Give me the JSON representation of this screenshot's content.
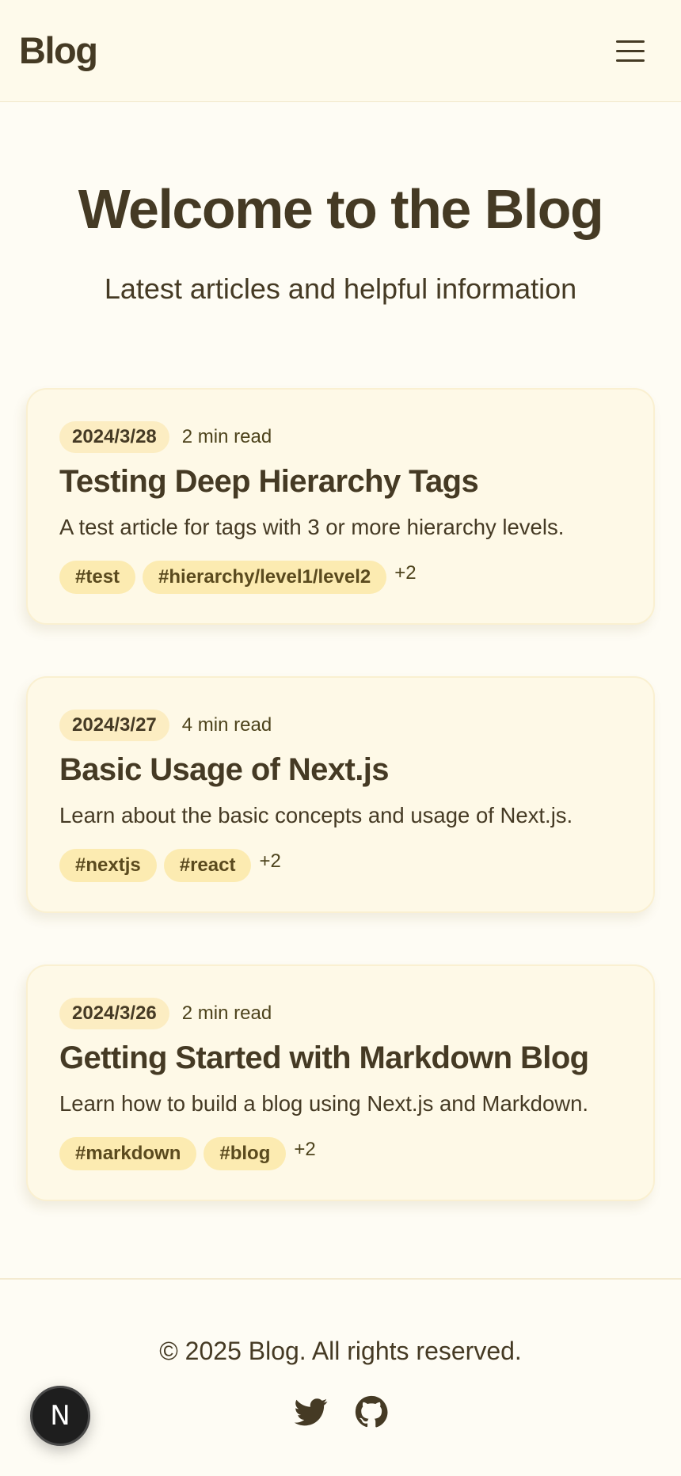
{
  "header": {
    "brand": "Blog",
    "menu_icon": "hamburger-menu-icon"
  },
  "hero": {
    "title": "Welcome to the Blog",
    "subtitle": "Latest articles and helpful information"
  },
  "posts": [
    {
      "date": "2024/3/28",
      "read_time": "2 min read",
      "title": "Testing Deep Hierarchy Tags",
      "description": "A test article for tags with 3 or more hierarchy levels.",
      "tags": [
        "#test",
        "#hierarchy/level1/level2"
      ],
      "more_tags": "+2"
    },
    {
      "date": "2024/3/27",
      "read_time": "4 min read",
      "title": "Basic Usage of Next.js",
      "description": "Learn about the basic concepts and usage of Next.js.",
      "tags": [
        "#nextjs",
        "#react"
      ],
      "more_tags": "+2"
    },
    {
      "date": "2024/3/26",
      "read_time": "2 min read",
      "title": "Getting Started with Markdown Blog",
      "description": "Learn how to build a blog using Next.js and Markdown.",
      "tags": [
        "#markdown",
        "#blog"
      ],
      "more_tags": "+2"
    }
  ],
  "footer": {
    "copyright": "© 2025 Blog. All rights reserved.",
    "social": [
      "twitter-icon",
      "github-icon"
    ]
  },
  "dev_badge": {
    "letter": "N"
  },
  "colors": {
    "background": "#fefcf4",
    "card": "#fef9e7",
    "tag": "#fcebb1",
    "text": "#453a24"
  }
}
